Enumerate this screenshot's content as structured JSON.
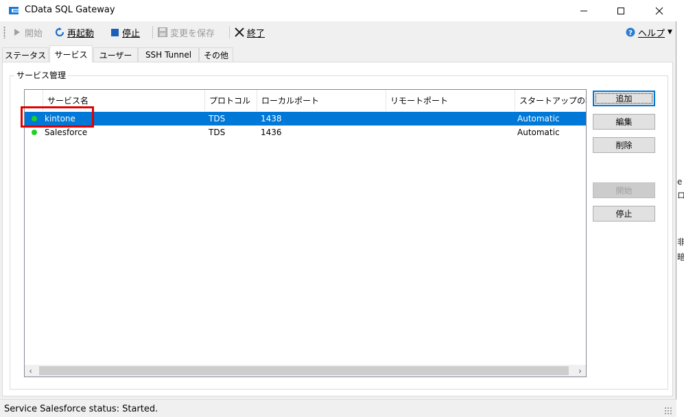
{
  "window": {
    "title": "CData SQL Gateway",
    "accent": "#0078d7"
  },
  "toolbar": {
    "start_label": "開始",
    "restart_label": "再起動",
    "stop_label": "停止",
    "save_label": "変更を保存",
    "exit_label": "終了",
    "help_label": "ヘルプ"
  },
  "tabs": [
    {
      "label": "ステータス",
      "active": false
    },
    {
      "label": "サービス",
      "active": true
    },
    {
      "label": "ユーザー",
      "active": false
    },
    {
      "label": "SSH Tunnel",
      "active": false
    },
    {
      "label": "その他",
      "active": false
    }
  ],
  "service_group": {
    "title": "サービス管理",
    "columns": [
      "サービス名",
      "プロトコル",
      "ローカルポート",
      "リモートポート",
      "スタートアップの種"
    ],
    "rows": [
      {
        "name": "kintone",
        "protocol": "TDS",
        "local_port": "1438",
        "remote_port": "",
        "startup": "Automatic",
        "status_color": "#1ed21e",
        "selected": true
      },
      {
        "name": "Salesforce",
        "protocol": "TDS",
        "local_port": "1436",
        "remote_port": "",
        "startup": "Automatic",
        "status_color": "#1ed21e",
        "selected": false
      }
    ]
  },
  "buttons": {
    "add": "追加",
    "edit": "編集",
    "delete": "削除",
    "start": "開始",
    "stop": "停止"
  },
  "statusbar": {
    "text": "Service Salesforce status: Started."
  },
  "background_peek": {
    "fragments": [
      "e",
      "ロ",
      "非",
      "暗"
    ]
  }
}
